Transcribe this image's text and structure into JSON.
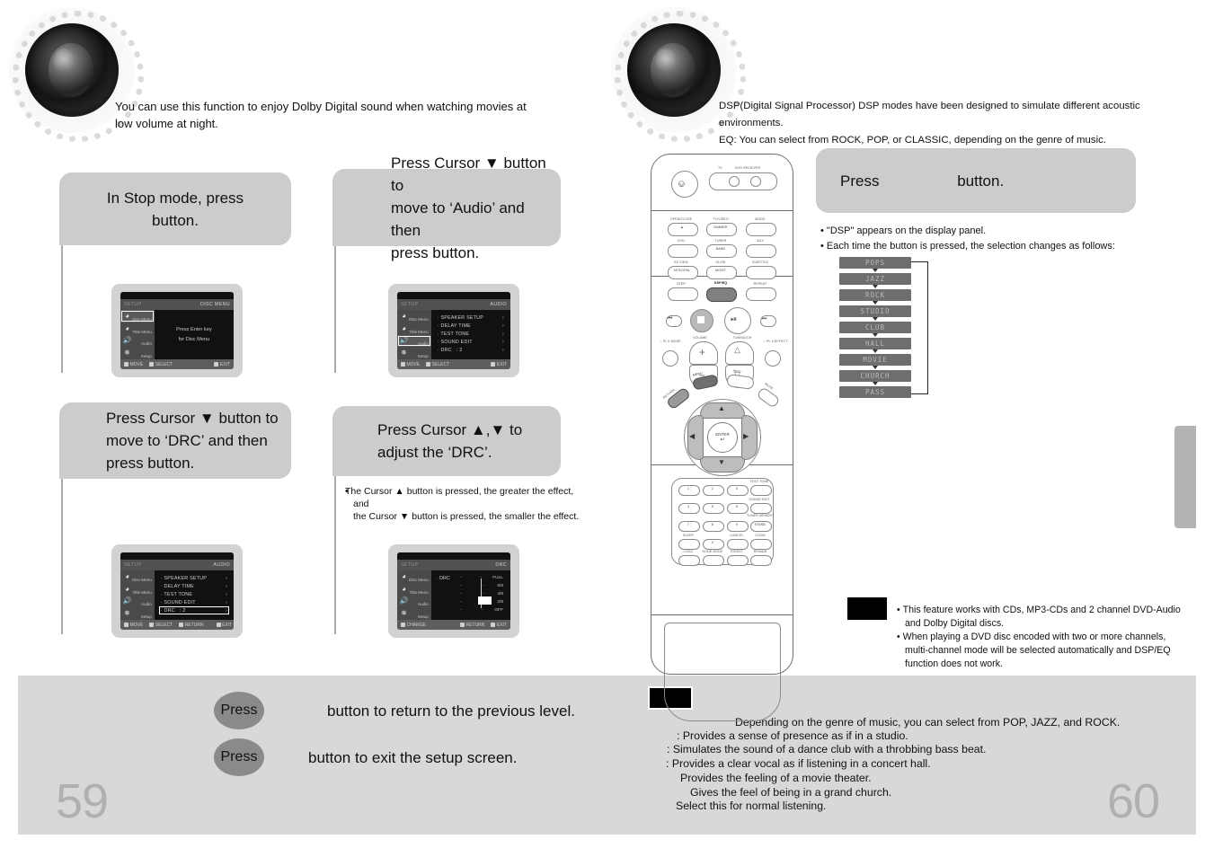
{
  "left_page": {
    "page_number": "59",
    "intro": {
      "line1": "You can use this function to enjoy Dolby Digital sound when watching movies at",
      "line2": "low volume at night."
    },
    "steps": [
      {
        "id": "step-1",
        "text": "In Stop mode, press button.",
        "line1": "In Stop mode, press",
        "line2": "button."
      },
      {
        "id": "step-2",
        "text": "Press Cursor ▼ button to move to ‘Audio’ and then press button.",
        "line1": "Press Cursor ▼ button to",
        "line2": "move to ‘Audio’ and then",
        "line3": "press            button."
      },
      {
        "id": "step-3",
        "text": "Press Cursor ▼ button to move to ‘DRC’ and then press button.",
        "line1": "Press Cursor ▼ button to",
        "line2": "move to ‘DRC’ and then",
        "line3": "press            button."
      },
      {
        "id": "step-4",
        "text": "Press Cursor ▲,▼ to adjust the ‘DRC’.",
        "line1": "Press Cursor ▲,▼ to",
        "line2": "adjust the ‘DRC’.",
        "note1": "The Cursor ▲ button is pressed, the greater the effect, and",
        "note2": "the Cursor ▼ button is pressed, the smaller the effect."
      }
    ],
    "screens": [
      {
        "id": "screen-disc-menu",
        "left_title": "SETUP",
        "right_title": "DISC MENU",
        "center_line1": "Press Enter key",
        "center_line2": "for Disc Menu",
        "sidebar": [
          "Disc Menu",
          "Title Menu",
          "Audio",
          "Setup"
        ],
        "selected_sidebar": "Disc Menu",
        "footer": [
          "MOVE",
          "SELECT",
          "EXIT"
        ]
      },
      {
        "id": "screen-audio-menu",
        "left_title": "SETUP",
        "right_title": "AUDIO",
        "sidebar": [
          "Disc Menu",
          "Title Menu",
          "Audio",
          "Setup"
        ],
        "selected_sidebar": "Audio",
        "rows": [
          {
            "label": "SPEAKER SETUP",
            "value": ""
          },
          {
            "label": "DELAY TIME",
            "value": ""
          },
          {
            "label": "TEST TONE",
            "value": ""
          },
          {
            "label": "SOUND EDIT",
            "value": ""
          },
          {
            "label": "DRC",
            "value": ": 2"
          }
        ],
        "highlight_row": -1,
        "footer": [
          "MOVE",
          "SELECT",
          "EXIT"
        ]
      },
      {
        "id": "screen-audio-drc-highlight",
        "left_title": "SETUP",
        "right_title": "AUDIO",
        "sidebar": [
          "Disc Menu",
          "Title Menu",
          "Audio",
          "Setup"
        ],
        "selected_sidebar": "Audio",
        "rows": [
          {
            "label": "SPEAKER SETUP",
            "value": ""
          },
          {
            "label": "DELAY TIME",
            "value": ""
          },
          {
            "label": "TEST TONE",
            "value": ""
          },
          {
            "label": "SOUND EDIT",
            "value": ""
          },
          {
            "label": "DRC",
            "value": ": 2"
          }
        ],
        "highlight_row": 4,
        "footer": [
          "MOVE",
          "SELECT",
          "RETURN",
          "EXIT"
        ]
      },
      {
        "id": "screen-drc-slider",
        "left_title": "SETUP",
        "right_title": "DRC",
        "sidebar": [
          "Disc Menu",
          "Title Menu",
          "Audio",
          "Setup"
        ],
        "selected_sidebar": "",
        "row_label": "DRC",
        "ticks": [
          "FULL",
          "6/8",
          "4/8",
          "2/8",
          "OFF"
        ],
        "selected_tick": "2/8",
        "footer": [
          "CHANGE",
          "RETURN",
          "EXIT"
        ]
      }
    ],
    "footer_actions": [
      {
        "pill": "Press",
        "text": "button to return to the previous level."
      },
      {
        "pill": "Press",
        "text": "button to exit the setup screen."
      }
    ]
  },
  "right_page": {
    "page_number": "60",
    "intro": {
      "line1": "DSP(Digital Signal Processor) DSP modes have been designed to simulate different acoustic environments.",
      "line2": "EQ: You can select from ROCK, POP, or CLASSIC, depending on the genre of music."
    },
    "step": {
      "id": "step-dsp",
      "line1": "Press",
      "line2": "button."
    },
    "bullets": [
      "\"DSP\" appears on the display panel.",
      "Each time the button is pressed, the selection changes as follows:"
    ],
    "dsp_modes": [
      "POPS",
      "JAZZ",
      "ROCK",
      "STUDIO",
      "CLUB",
      "HALL",
      "MOVIE",
      "CHURCH",
      "PASS"
    ],
    "note": {
      "bullets": [
        "This feature works with CDs, MP3-CDs and 2 channel DVD-Audio and Dolby Digital discs.",
        "When playing a DVD disc encoded with two or more channels, multi-channel mode will be selected automatically and DSP/EQ function does not work."
      ]
    },
    "descriptions": [
      "Depending on the genre of music, you can select from POP, JAZZ, and ROCK.",
      ": Provides a sense of presence as if in a studio.",
      ": Simulates the sound of a dance club with a throbbing bass beat.",
      ": Provides a clear vocal as if listening in a concert hall.",
      "Provides the feeling of a movie theater.",
      "Gives the feel of being in a grand church.",
      "Select this for normal listening."
    ]
  },
  "remote": {
    "name": "dvd-receiver-remote-control",
    "groups": {
      "power_row": {
        "power": "⏻/I",
        "tv": "TV",
        "dvd_receiver": "DVD RECEIVER"
      },
      "row1": [
        {
          "top": "OPEN/CLOSE",
          "inner": "▲"
        },
        {
          "top": "TV/VIDEO",
          "inner": "DIMMER"
        },
        {
          "top": "MODE",
          "inner": ""
        }
      ],
      "row2": [
        {
          "top": "DVD",
          "inner": ""
        },
        {
          "top": "TUNER",
          "inner": "BAND"
        },
        {
          "top": "AUX",
          "inner": ""
        }
      ],
      "row3": [
        {
          "top": "EZ VIEW",
          "inner": "NTSC/PAL"
        },
        {
          "top": "SLOW",
          "inner": "MO/ST"
        },
        {
          "top": "SUBTITLE",
          "inner": ""
        }
      ],
      "row4": [
        {
          "top": "STEP",
          "inner": ""
        },
        {
          "top": "DSP/EQ",
          "inner": "",
          "highlighted": true
        },
        {
          "top": "REPEAT",
          "inner": ""
        }
      ],
      "transport": [
        "⏮",
        "■",
        "▶❙❙",
        "⏭"
      ],
      "volume_label": "VOLUME",
      "tuning_label": "TUNING/CH",
      "plii_mode": "∴ PL II MODE",
      "plii_effect": "∴ PL II EFFECT",
      "menu": "MENU",
      "info": "INFO",
      "return": "RETURN",
      "mute": "MUTE",
      "enter": "ENTER",
      "keypad": [
        [
          "1",
          "2",
          "3"
        ],
        [
          "4",
          "5",
          "6"
        ],
        [
          "7",
          "8",
          "9"
        ]
      ],
      "right_col": [
        "TEST TONE",
        "SOUND EDIT",
        "TUNER MEMORY",
        "ZOOM",
        "REMAIN"
      ],
      "bottom_row": [
        {
          "top": "SLEEP",
          "inner": ""
        },
        {
          "top": "",
          "inner": "0"
        },
        {
          "top": "CANCEL",
          "inner": ""
        },
        {
          "top": "ZOOM",
          "inner": ""
        }
      ],
      "last_row": [
        {
          "top": "LOGO",
          "inner": ""
        },
        {
          "top": "SLIDE MODE",
          "inner": ""
        },
        {
          "top": "DIGEST",
          "inner": ""
        },
        {
          "top": "REMAIN",
          "inner": ""
        }
      ],
      "stand_by_inner": "STAND"
    }
  },
  "colors": {
    "band": "#d8d8d8",
    "bubble": "#cccccc",
    "tv_bezel": "#d2d2d2",
    "dsp_item": "#6e6e6e",
    "pill": "#8a8a8a",
    "page_number": "#b0b0b0",
    "edge_tab": "#b3b3b3"
  }
}
